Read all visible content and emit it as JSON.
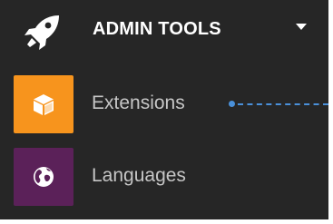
{
  "header": {
    "title": "ADMIN TOOLS",
    "icon": "rocket-icon",
    "expand_icon": "caret-down-icon"
  },
  "menu": {
    "items": [
      {
        "label": "Extensions",
        "icon": "cube-icon",
        "tile_color": "#f7941d"
      },
      {
        "label": "Languages",
        "icon": "globe-icon",
        "tile_color": "#5b2159"
      }
    ]
  },
  "callout": {
    "color": "#4a90d9"
  },
  "colors": {
    "panel_background": "#262626",
    "header_text": "#ffffff",
    "item_text": "#c6c6c6"
  }
}
